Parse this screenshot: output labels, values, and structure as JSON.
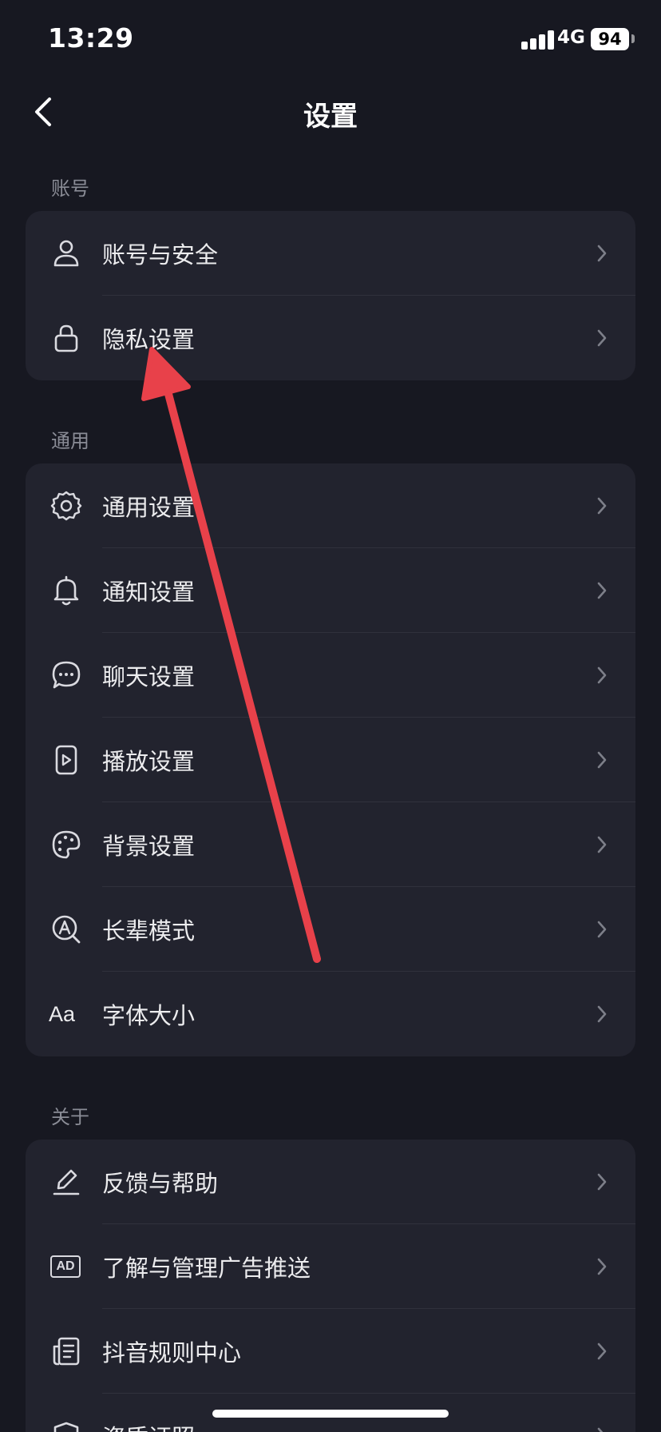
{
  "status_bar": {
    "time": "13:29",
    "network": "4G",
    "battery": "94"
  },
  "nav": {
    "title": "设置",
    "back_icon": "chevron-left-icon"
  },
  "sections": {
    "account": {
      "label": "账号",
      "items": [
        {
          "label": "账号与安全",
          "icon": "user-icon"
        },
        {
          "label": "隐私设置",
          "icon": "lock-icon"
        }
      ]
    },
    "general": {
      "label": "通用",
      "items": [
        {
          "label": "通用设置",
          "icon": "gear-icon"
        },
        {
          "label": "通知设置",
          "icon": "bell-icon"
        },
        {
          "label": "聊天设置",
          "icon": "chat-bubble-icon"
        },
        {
          "label": "播放设置",
          "icon": "play-file-icon"
        },
        {
          "label": "背景设置",
          "icon": "palette-icon"
        },
        {
          "label": "长辈模式",
          "icon": "elder-mode-icon"
        },
        {
          "label": "字体大小",
          "icon": "font-size-icon",
          "icon_text": "Aa"
        }
      ]
    },
    "about": {
      "label": "关于",
      "items": [
        {
          "label": "反馈与帮助",
          "icon": "edit-pen-icon"
        },
        {
          "label": "了解与管理广告推送",
          "icon": "ad-icon",
          "icon_text": "AD"
        },
        {
          "label": "抖音规则中心",
          "icon": "document-list-icon"
        },
        {
          "label": "资质证照",
          "icon": "shield-icon"
        }
      ]
    }
  },
  "colors": {
    "background": "#171821",
    "card": "#22232E",
    "annotation_arrow": "#E8414A"
  }
}
